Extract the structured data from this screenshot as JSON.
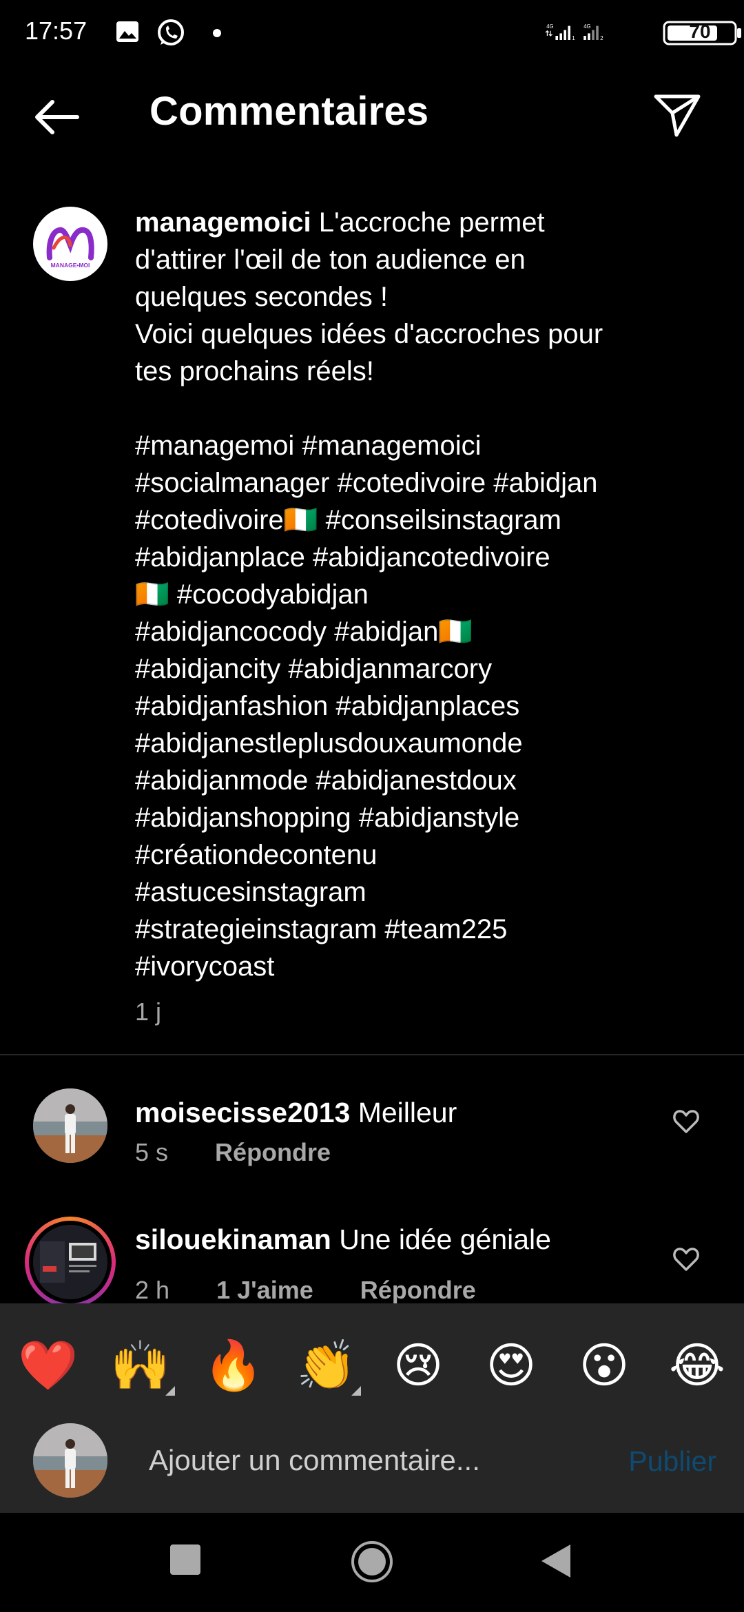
{
  "status_bar": {
    "time": "17:57",
    "battery": "70",
    "icons": [
      "gallery-icon",
      "whatsapp-icon",
      "notification-dot",
      "signal-4g-1-icon",
      "signal-4g-2-icon",
      "battery-icon"
    ]
  },
  "header": {
    "title": "Commentaires",
    "back_icon": "back-arrow-icon",
    "share_icon": "send-icon"
  },
  "caption": {
    "username": "managemoici",
    "avatar_logo_text": "MANAGE MOI",
    "text": " L'accroche permet\nd'attirer l'œil de ton audience en\nquelques secondes !\nVoici quelques idées d'accroches pour\ntes prochains réels!\n\n#managemoi #managemoici\n#socialmanager #cotedivoire #abidjan\n#cotedivoire🇨🇮 #conseilsinstagram\n#abidjanplace #abidjancotedivoire\n🇨🇮 #cocodyabidjan\n#abidjancocody #abidjan🇨🇮\n#abidjancity #abidjanmarcory\n#abidjanfashion #abidjanplaces\n#abidjanestleplusdouxaumonde\n#abidjanmode #abidjanestdoux\n#abidjanshopping #abidjanstyle\n#créationdecontenu\n#astucesinstagram\n#strategieinstagram #team225\n#ivorycoast",
    "time": "1 j"
  },
  "comments": [
    {
      "username": "moisecisse2013",
      "text": " Meilleur",
      "time": "5 s",
      "reply_label": "Répondre",
      "likes_label": ""
    },
    {
      "username": "silouekinaman",
      "text": " Une idée géniale",
      "time": "2 h",
      "likes_label": "1 J'aime",
      "reply_label": "Répondre"
    }
  ],
  "reactions": [
    "❤️",
    "🙌",
    "🔥",
    "👏",
    "😢",
    "😍",
    "😮",
    "😂"
  ],
  "composer": {
    "placeholder": "Ajouter un commentaire...",
    "publish_label": "Publier"
  },
  "colors": {
    "background": "#000000",
    "secondary_text": "#a8a8a8",
    "bar_background": "#262626",
    "publish_disabled": "#0e4a72"
  }
}
